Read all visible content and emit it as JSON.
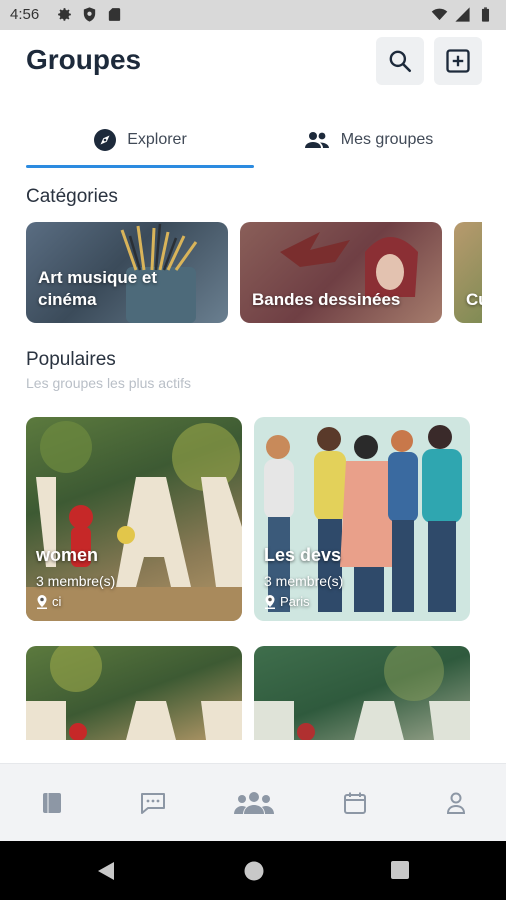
{
  "status_bar": {
    "time": "4:56",
    "left_icons": [
      "settings-icon",
      "shield-icon",
      "sim-card-icon"
    ],
    "right_icons": [
      "wifi-icon",
      "signal-icon",
      "battery-icon"
    ]
  },
  "header": {
    "title": "Groupes",
    "search_icon": "search-icon",
    "add_icon": "add-box-icon"
  },
  "tabs": [
    {
      "label": "Explorer",
      "icon": "compass-icon",
      "active": true
    },
    {
      "label": "Mes groupes",
      "icon": "people-icon",
      "active": false
    }
  ],
  "categories": {
    "title": "Catégories",
    "items": [
      {
        "label": "Art musique et cinéma"
      },
      {
        "label": "Bandes dessinées"
      },
      {
        "label": "Cu"
      }
    ]
  },
  "popular": {
    "title": "Populaires",
    "subtitle": "Les groupes les plus actifs",
    "groups": [
      {
        "name": "women",
        "members": "3 membre(s)",
        "location": "ci"
      },
      {
        "name": "Les devs",
        "members": "3 membre(s)",
        "location": "Paris"
      }
    ]
  },
  "bottom_nav": {
    "items": [
      "book-icon",
      "chat-icon",
      "groups-icon",
      "calendar-icon",
      "person-icon"
    ],
    "active_index": 2
  },
  "colors": {
    "accent": "#2c8be0",
    "title": "#1d2a3b",
    "nav_icon": "#8d97a5"
  }
}
